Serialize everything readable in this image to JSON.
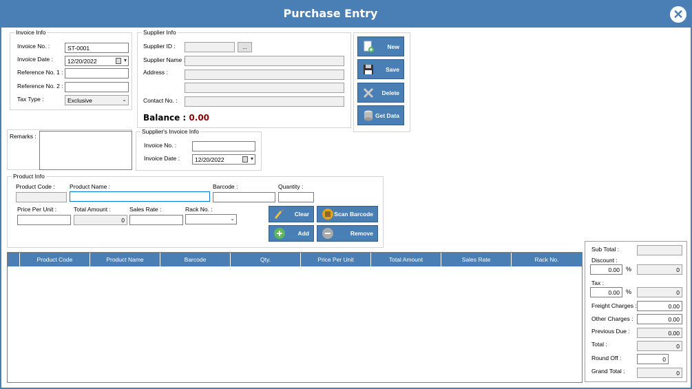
{
  "window": {
    "title": "Purchase Entry"
  },
  "invoice_info": {
    "group_label": "Invoice Info",
    "invoice_no_label": "Invoice No. :",
    "invoice_no_value": "ST-0001",
    "invoice_date_label": "Invoice Date :",
    "invoice_date_value": "12/20/2022",
    "ref1_label": "Reference No. 1 :",
    "ref2_label": "Reference No. 2 :",
    "tax_type_label": "Tax Type :",
    "tax_type_value": "Exclusive"
  },
  "supplier_info": {
    "group_label": "Supplier Info",
    "supplier_id_label": "Supplier ID :",
    "browse_label": "...",
    "supplier_name_label": "Supplier Name :",
    "address_label": "Address :",
    "contact_label": "Contact No. :",
    "balance_label": "Balance :",
    "balance_value": "0.00"
  },
  "actions": {
    "new_label": "New",
    "save_label": "Save",
    "delete_label": "Delete",
    "get_data_label": "Get Data"
  },
  "remarks": {
    "label": "Remarks :"
  },
  "supplier_invoice_info": {
    "group_label": "Supplier's Invoice Info",
    "invoice_no_label": "Invoice No. :",
    "invoice_date_label": "Invoice Date :",
    "invoice_date_value": "12/20/2022"
  },
  "product_info": {
    "group_label": "Product Info",
    "product_code_label": "Product Code :",
    "product_name_label": "Product Name :",
    "barcode_label": "Barcode :",
    "quantity_label": "Quantity :",
    "price_per_unit_label": "Price Per Unit :",
    "total_amount_label": "Total Amount :",
    "total_amount_value": "0",
    "sales_rate_label": "Sales Rate :",
    "rack_no_label": "Rack No. :",
    "clear_label": "Clear",
    "scan_barcode_label": "Scan Barcode",
    "add_label": "Add",
    "remove_label": "Remove"
  },
  "grid": {
    "columns": [
      "Product Code",
      "Product Name",
      "Barcode",
      "Qty.",
      "Price Per Unit",
      "Total Amount",
      "Sales Rate",
      "Rack No."
    ]
  },
  "totals": {
    "sub_total_label": "Sub Total :",
    "sub_total_value": "",
    "discount_label": "Discount :",
    "discount_percent": "0.00",
    "discount_value": "0",
    "tax_label": "Tax :",
    "tax_percent": "0.00",
    "tax_value": "0",
    "freight_label": "Freight Charges :",
    "freight_value": "0.00",
    "other_label": "Other Charges :",
    "other_value": "0.00",
    "previous_due_label": "Previous Due :",
    "previous_due_value": "0.00",
    "total_label": "Total :",
    "total_value": "0",
    "round_off_label": "Round Off :",
    "round_off_value": "0",
    "grand_total_label": "Grand Total :",
    "grand_total_value": "0",
    "percent_sign": "%"
  },
  "colors": {
    "accent": "#4a7fb5",
    "balance": "#8b0000"
  }
}
